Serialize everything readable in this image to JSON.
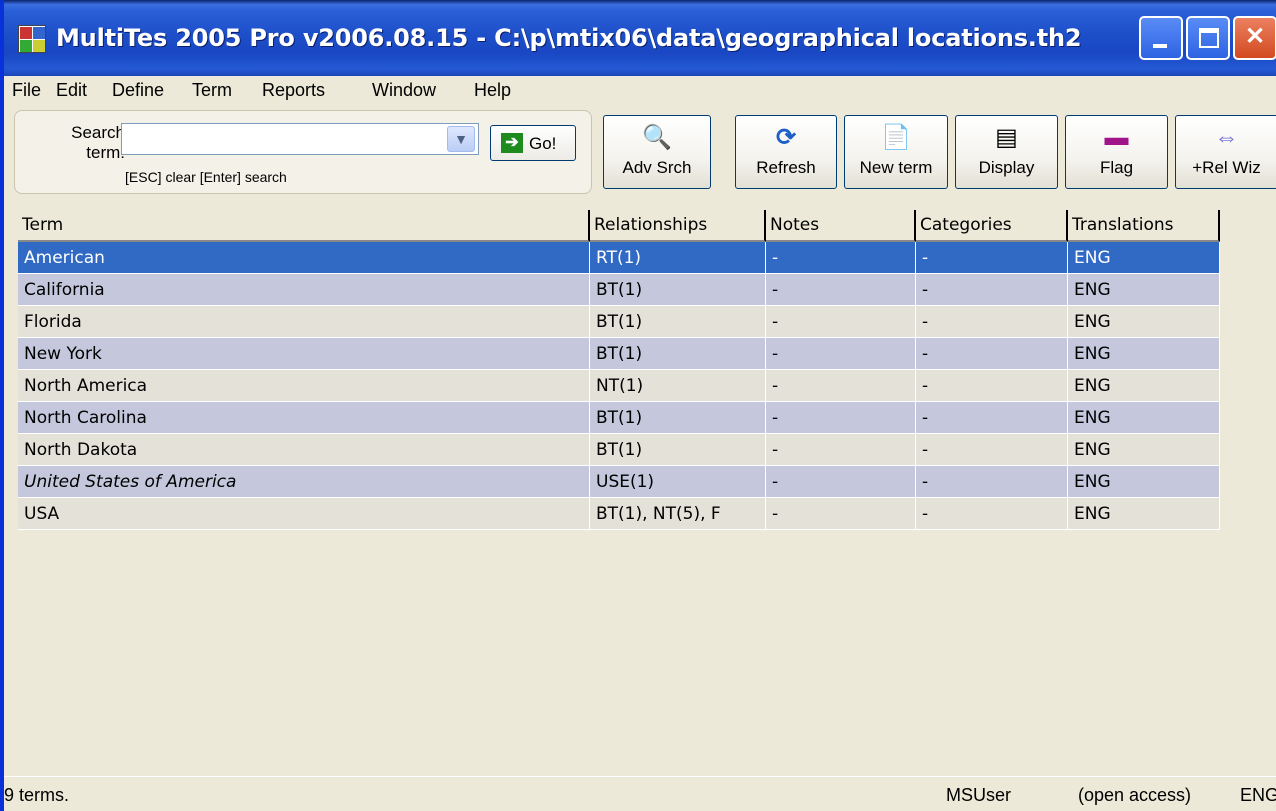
{
  "window": {
    "title": "MultiTes 2005 Pro v2006.08.15 - C:\\p\\mtix06\\data\\geographical locations.th2"
  },
  "menu": [
    "File",
    "Edit",
    "Define",
    "Term",
    "Reports",
    "Window",
    "Help"
  ],
  "search": {
    "label": "Search term:",
    "value": "",
    "hint": "[ESC] clear  [Enter] search",
    "go_label": "Go!"
  },
  "toolbar": {
    "adv_search": "Adv Srch",
    "refresh": "Refresh",
    "new_term": "New term",
    "display": "Display",
    "flag": "Flag",
    "rel_wiz": "+Rel Wiz"
  },
  "grid": {
    "columns": [
      "Term",
      "Relationships",
      "Notes",
      "Categories",
      "Translations"
    ],
    "rows": [
      {
        "term": "American",
        "relationships": "RT(1)",
        "notes": "-",
        "categories": "-",
        "translations": "ENG"
      },
      {
        "term": "California",
        "relationships": "BT(1)",
        "notes": "-",
        "categories": "-",
        "translations": "ENG"
      },
      {
        "term": "Florida",
        "relationships": "BT(1)",
        "notes": "-",
        "categories": "-",
        "translations": "ENG"
      },
      {
        "term": "New York",
        "relationships": "BT(1)",
        "notes": "-",
        "categories": "-",
        "translations": "ENG"
      },
      {
        "term": "North America",
        "relationships": "NT(1)",
        "notes": "-",
        "categories": "-",
        "translations": "ENG"
      },
      {
        "term": "North Carolina",
        "relationships": "BT(1)",
        "notes": "-",
        "categories": "-",
        "translations": "ENG"
      },
      {
        "term": "North Dakota",
        "relationships": "BT(1)",
        "notes": "-",
        "categories": "-",
        "translations": "ENG"
      },
      {
        "term": "United States of America",
        "relationships": "USE(1)",
        "notes": "-",
        "categories": "-",
        "translations": "ENG"
      },
      {
        "term": "USA",
        "relationships": "BT(1), NT(5), F",
        "notes": "-",
        "categories": "-",
        "translations": "ENG"
      }
    ]
  },
  "status": {
    "count": "9 terms.",
    "user": "MSUser",
    "access": "(open access)",
    "lang": "ENG"
  },
  "colors": {
    "selection": "#316ac5",
    "row_alt": "#c5c8dd",
    "row_base": "#e3e1d8",
    "titlebar": "#1d4fc9"
  }
}
